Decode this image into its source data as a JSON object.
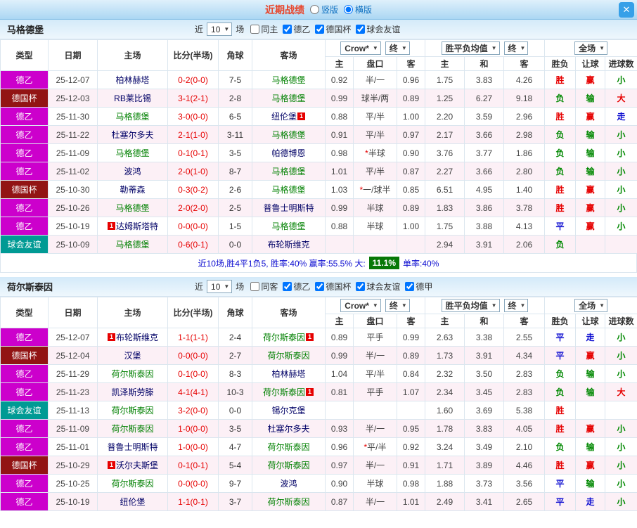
{
  "topbar": {
    "title": "近期战绩",
    "layout_options": [
      {
        "label": "竖版",
        "selected": false
      },
      {
        "label": "横版",
        "selected": true
      }
    ],
    "close_label": "✕"
  },
  "filter_labels": {
    "near": "近",
    "games": "场"
  },
  "table_header": {
    "cols": [
      "类型",
      "日期",
      "主场",
      "比分(半场)",
      "角球",
      "客场"
    ],
    "odds_company_select": "Crow*",
    "odds_final_select": "终",
    "odds_cols": [
      "主",
      "盘口",
      "客"
    ],
    "avg_select": "胜平负均值",
    "avg_final_select": "终",
    "avg_cols": [
      "主",
      "和",
      "客"
    ],
    "scope_select": "全场",
    "result_cols": [
      "胜负",
      "让球",
      "进球数"
    ]
  },
  "type_colors": {
    "德乙": "#cc00cc",
    "德国杯": "#921414",
    "球会友谊": "#009a94",
    "德甲": "#cc6600"
  },
  "result_colors": {
    "胜": "#e60000",
    "负": "#008800",
    "平": "#0b0bd0",
    "赢": "#e60000",
    "输": "#008800",
    "走": "#0b0bd0",
    "大": "#e60000",
    "小": "#008800"
  },
  "tables": [
    {
      "team": "马格德堡",
      "filter": {
        "count": "10",
        "checkboxes": [
          {
            "label": "同主",
            "checked": false
          },
          {
            "label": "德乙",
            "checked": true
          },
          {
            "label": "德国杯",
            "checked": true
          },
          {
            "label": "球会友谊",
            "checked": true
          }
        ]
      },
      "rows": [
        {
          "type": "德乙",
          "date": "25-12-07",
          "home": "柏林赫塔",
          "score": "0-2(0-0)",
          "corner": "7-5",
          "away": "马格德堡",
          "away_focus": true,
          "o1": "0.92",
          "line": "半/一",
          "o2": "0.96",
          "a1": "1.75",
          "a2": "3.83",
          "a3": "4.26",
          "r1": "胜",
          "r2": "赢",
          "r3": "小"
        },
        {
          "type": "德国杯",
          "date": "25-12-03",
          "home": "RB莱比锡",
          "score": "3-1(2-1)",
          "corner": "2-8",
          "away": "马格德堡",
          "away_focus": true,
          "o1": "0.99",
          "line": "球半/两",
          "o2": "0.89",
          "a1": "1.25",
          "a2": "6.27",
          "a3": "9.18",
          "r1": "负",
          "r2": "输",
          "r3": "大"
        },
        {
          "type": "德乙",
          "date": "25-11-30",
          "home": "马格德堡",
          "home_focus": true,
          "score": "3-0(0-0)",
          "corner": "6-5",
          "away": "纽伦堡",
          "away_badge": "1",
          "o1": "0.88",
          "line": "平/半",
          "o2": "1.00",
          "a1": "2.20",
          "a2": "3.59",
          "a3": "2.96",
          "r1": "胜",
          "r2": "赢",
          "r3": "走"
        },
        {
          "type": "德乙",
          "date": "25-11-22",
          "home": "杜塞尔多夫",
          "score": "2-1(1-0)",
          "corner": "3-11",
          "away": "马格德堡",
          "away_focus": true,
          "o1": "0.91",
          "line": "平/半",
          "o2": "0.97",
          "a1": "2.17",
          "a2": "3.66",
          "a3": "2.98",
          "r1": "负",
          "r2": "输",
          "r3": "小"
        },
        {
          "type": "德乙",
          "date": "25-11-09",
          "home": "马格德堡",
          "home_focus": true,
          "score": "0-1(0-1)",
          "corner": "3-5",
          "away": "帕德博恩",
          "o1": "0.98",
          "line": "*半球",
          "o2": "0.90",
          "a1": "3.76",
          "a2": "3.77",
          "a3": "1.86",
          "r1": "负",
          "r2": "输",
          "r3": "小"
        },
        {
          "type": "德乙",
          "date": "25-11-02",
          "home": "波鸿",
          "score": "2-0(1-0)",
          "corner": "8-7",
          "away": "马格德堡",
          "away_focus": true,
          "o1": "1.01",
          "line": "平/半",
          "o2": "0.87",
          "a1": "2.27",
          "a2": "3.66",
          "a3": "2.80",
          "r1": "负",
          "r2": "输",
          "r3": "小"
        },
        {
          "type": "德国杯",
          "date": "25-10-30",
          "home": "勒蒂森",
          "score": "0-3(0-2)",
          "corner": "2-6",
          "away": "马格德堡",
          "away_focus": true,
          "o1": "1.03",
          "line": "*一/球半",
          "o2": "0.85",
          "a1": "6.51",
          "a2": "4.95",
          "a3": "1.40",
          "r1": "胜",
          "r2": "赢",
          "r3": "小"
        },
        {
          "type": "德乙",
          "date": "25-10-26",
          "home": "马格德堡",
          "home_focus": true,
          "score": "2-0(2-0)",
          "corner": "2-5",
          "away": "普鲁士明斯特",
          "o1": "0.99",
          "line": "半球",
          "o2": "0.89",
          "a1": "1.83",
          "a2": "3.86",
          "a3": "3.78",
          "r1": "胜",
          "r2": "赢",
          "r3": "小"
        },
        {
          "type": "德乙",
          "date": "25-10-19",
          "home": "达姆斯塔特",
          "home_badge": "1",
          "score": "0-0(0-0)",
          "corner": "1-5",
          "away": "马格德堡",
          "away_focus": true,
          "o1": "0.88",
          "line": "半球",
          "o2": "1.00",
          "a1": "1.75",
          "a2": "3.88",
          "a3": "4.13",
          "r1": "平",
          "r2": "赢",
          "r3": "小"
        },
        {
          "type": "球会友谊",
          "date": "25-10-09",
          "home": "马格德堡",
          "home_focus": true,
          "score": "0-6(0-1)",
          "corner": "0-0",
          "away": "布轮斯维克",
          "o1": "",
          "line": "",
          "o2": "",
          "a1": "2.94",
          "a2": "3.91",
          "a3": "2.06",
          "r1": "负",
          "r2": "",
          "r3": ""
        }
      ],
      "summary": {
        "before": "近10场,胜4平1负5, 胜率:40% 赢率:55.5% 大:",
        "highlight": "11.1%",
        "after": "单率:40%"
      }
    },
    {
      "team": "荷尔斯泰因",
      "filter": {
        "count": "10",
        "checkboxes": [
          {
            "label": "同客",
            "checked": false
          },
          {
            "label": "德乙",
            "checked": true
          },
          {
            "label": "德国杯",
            "checked": true
          },
          {
            "label": "球会友谊",
            "checked": true
          },
          {
            "label": "德甲",
            "checked": true
          }
        ]
      },
      "rows": [
        {
          "type": "德乙",
          "date": "25-12-07",
          "home": "布轮斯维克",
          "home_badge": "1",
          "score": "1-1(1-1)",
          "corner": "2-4",
          "away": "荷尔斯泰因",
          "away_focus": true,
          "away_badge": "1",
          "o1": "0.89",
          "line": "平手",
          "o2": "0.99",
          "a1": "2.63",
          "a2": "3.38",
          "a3": "2.55",
          "r1": "平",
          "r2": "走",
          "r3": "小"
        },
        {
          "type": "德国杯",
          "date": "25-12-04",
          "home": "汉堡",
          "score": "0-0(0-0)",
          "corner": "2-7",
          "away": "荷尔斯泰因",
          "away_focus": true,
          "o1": "0.99",
          "line": "半/一",
          "o2": "0.89",
          "a1": "1.73",
          "a2": "3.91",
          "a3": "4.34",
          "r1": "平",
          "r2": "赢",
          "r3": "小"
        },
        {
          "type": "德乙",
          "date": "25-11-29",
          "home": "荷尔斯泰因",
          "home_focus": true,
          "score": "0-1(0-0)",
          "corner": "8-3",
          "away": "柏林赫塔",
          "o1": "1.04",
          "line": "平/半",
          "o2": "0.84",
          "a1": "2.32",
          "a2": "3.50",
          "a3": "2.83",
          "r1": "负",
          "r2": "输",
          "r3": "小"
        },
        {
          "type": "德乙",
          "date": "25-11-23",
          "home": "凯泽斯劳滕",
          "score": "4-1(4-1)",
          "corner": "10-3",
          "away": "荷尔斯泰因",
          "away_focus": true,
          "away_badge": "1",
          "o1": "0.81",
          "line": "平手",
          "o2": "1.07",
          "a1": "2.34",
          "a2": "3.45",
          "a3": "2.83",
          "r1": "负",
          "r2": "输",
          "r3": "大"
        },
        {
          "type": "球会友谊",
          "date": "25-11-13",
          "home": "荷尔斯泰因",
          "home_focus": true,
          "score": "3-2(0-0)",
          "corner": "0-0",
          "away": "锡尔克堡",
          "o1": "",
          "line": "",
          "o2": "",
          "a1": "1.60",
          "a2": "3.69",
          "a3": "5.38",
          "r1": "胜",
          "r2": "",
          "r3": ""
        },
        {
          "type": "德乙",
          "date": "25-11-09",
          "home": "荷尔斯泰因",
          "home_focus": true,
          "score": "1-0(0-0)",
          "corner": "3-5",
          "away": "杜塞尔多夫",
          "o1": "0.93",
          "line": "半/一",
          "o2": "0.95",
          "a1": "1.78",
          "a2": "3.83",
          "a3": "4.05",
          "r1": "胜",
          "r2": "赢",
          "r3": "小"
        },
        {
          "type": "德乙",
          "date": "25-11-01",
          "home": "普鲁士明斯特",
          "score": "1-0(0-0)",
          "corner": "4-7",
          "away": "荷尔斯泰因",
          "away_focus": true,
          "o1": "0.96",
          "line": "*平/半",
          "o2": "0.92",
          "a1": "3.24",
          "a2": "3.49",
          "a3": "2.10",
          "r1": "负",
          "r2": "输",
          "r3": "小"
        },
        {
          "type": "德国杯",
          "date": "25-10-29",
          "home": "沃尔夫斯堡",
          "home_badge": "1",
          "score": "0-1(0-1)",
          "corner": "5-4",
          "away": "荷尔斯泰因",
          "away_focus": true,
          "o1": "0.97",
          "line": "半/一",
          "o2": "0.91",
          "a1": "1.71",
          "a2": "3.89",
          "a3": "4.46",
          "r1": "胜",
          "r2": "赢",
          "r3": "小"
        },
        {
          "type": "德乙",
          "date": "25-10-25",
          "home": "荷尔斯泰因",
          "home_focus": true,
          "score": "0-0(0-0)",
          "corner": "9-7",
          "away": "波鸿",
          "o1": "0.90",
          "line": "半球",
          "o2": "0.98",
          "a1": "1.88",
          "a2": "3.73",
          "a3": "3.56",
          "r1": "平",
          "r2": "输",
          "r3": "小"
        },
        {
          "type": "德乙",
          "date": "25-10-19",
          "home": "纽伦堡",
          "score": "1-1(0-1)",
          "corner": "3-7",
          "away": "荷尔斯泰因",
          "away_focus": true,
          "o1": "0.87",
          "line": "半/一",
          "o2": "1.01",
          "a1": "2.49",
          "a2": "3.41",
          "a3": "2.65",
          "r1": "平",
          "r2": "走",
          "r3": "小"
        }
      ]
    }
  ]
}
